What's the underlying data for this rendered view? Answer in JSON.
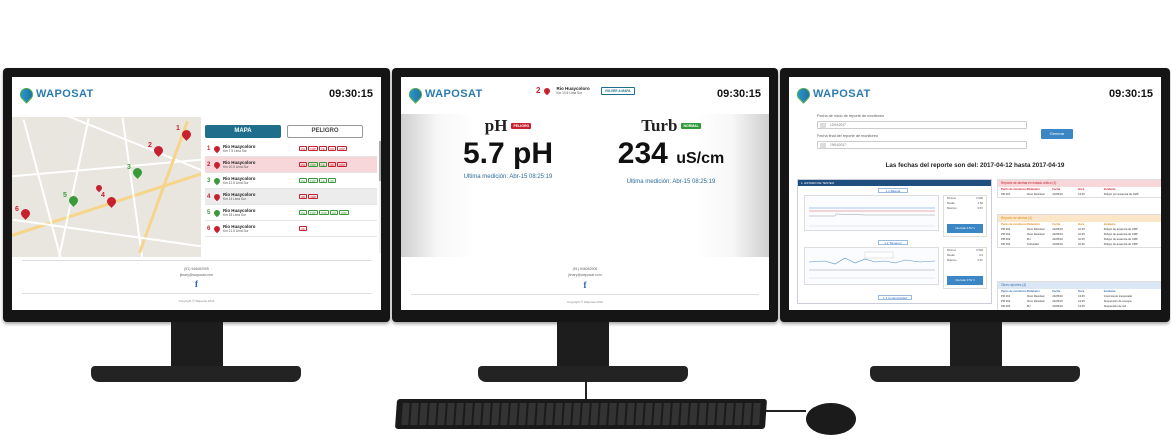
{
  "app": {
    "logo": "WAPOSAT",
    "clock": "09:30:15"
  },
  "colors": {
    "brand_blue": "#1e6e8c",
    "alert_red": "#c8202f",
    "normal_green": "#3a9a3a",
    "button_blue": "#3b86c5"
  },
  "left": {
    "tabs": [
      "MAPA",
      "PELIGRO"
    ],
    "active_tab": "MAPA",
    "map_pins": [
      {
        "num": "1",
        "status": "red"
      },
      {
        "num": "2",
        "status": "red"
      },
      {
        "num": "3",
        "status": "green"
      },
      {
        "num": "4",
        "status": "red"
      },
      {
        "num": "5",
        "status": "green"
      },
      {
        "num": "6",
        "status": "red"
      }
    ],
    "stations": [
      {
        "num": "1",
        "status": "red",
        "name": "Rio Huaycoloro",
        "loc": "Km 7.5 Lima Sur",
        "chips": [
          [
            "PH",
            "red"
          ],
          [
            "TMP",
            "red"
          ],
          [
            "CE",
            "red"
          ],
          [
            "OD",
            "red"
          ],
          [
            "ORP",
            "red"
          ]
        ]
      },
      {
        "num": "2",
        "status": "red",
        "name": "Rio Huaycoloro",
        "loc": "Km 10.5 Lima Sur",
        "chips": [
          [
            "PH",
            "red"
          ],
          [
            "TMP",
            "green"
          ],
          [
            "CE",
            "green"
          ],
          [
            "OD",
            "red"
          ],
          [
            "ORP",
            "red"
          ]
        ]
      },
      {
        "num": "3",
        "status": "green",
        "name": "Rio Huaycoloro",
        "loc": "Km 12.5 Lima Sur",
        "chips": [
          [
            "PH",
            "green"
          ],
          [
            "TMP",
            "green"
          ],
          [
            "CE",
            "green"
          ],
          [
            "OD",
            "green"
          ]
        ]
      },
      {
        "num": "4",
        "status": "red",
        "name": "Rio Huaycoloro",
        "loc": "Km 14 Lima Sur",
        "chips": [
          [
            "OD",
            "red"
          ],
          [
            "ORP",
            "red"
          ]
        ]
      },
      {
        "num": "5",
        "status": "green",
        "name": "Rio Huaycoloro",
        "loc": "Km 18 Lima Sur",
        "chips": [
          [
            "PH",
            "green"
          ],
          [
            "TMP",
            "green"
          ],
          [
            "TMP",
            "green"
          ],
          [
            "OD",
            "green"
          ],
          [
            "ORP",
            "green"
          ]
        ]
      },
      {
        "num": "6",
        "status": "red",
        "name": "Rio Huaycoloro",
        "loc": "Km 21.5 Lima Sur",
        "chips": [
          [
            "CE",
            "red"
          ]
        ]
      }
    ],
    "footer_phone": "(51) 946082905",
    "footer_email": "jlinary@waposat.com",
    "copyright": "Copyright © Waposat 2016"
  },
  "center": {
    "station": {
      "num": "2",
      "name": "Rio Huaycoloro",
      "loc": "Km 10.5 Lima Sur",
      "button": "VOLVER A MAPA"
    },
    "metrics": [
      {
        "label": "pH",
        "badge": "PELIGRO",
        "badge_color": "red",
        "value": "5.7",
        "unit": "pH",
        "measured": "Ultima medición: Abr-15 08:25:19"
      },
      {
        "label": "Turb",
        "badge": "NORMAL",
        "badge_color": "green",
        "value": "234",
        "unit": "uS/cm",
        "measured": "Ultima medición: Abr-15 08:25:19"
      }
    ],
    "footer_phone": "(51) 946082905",
    "footer_email": "jlinary@waposat.com",
    "copyright": "Copyright © Waposat 2016"
  },
  "right": {
    "start_label": "Fecha de inicio de reporte de monitoreo",
    "start_value": "12/04/2017",
    "end_label": "Fecha final del reporte de monitoreo",
    "end_value": "19/04/2017",
    "generate_button": "Generar",
    "report_title": "Las fechas del reporte son del: 2017-04-12 hasta 2017-04-19",
    "panel_title": "1. ESTADO DE TESTEO",
    "sub_tabs": [
      "1.1 Batería",
      "1.2 Tomacorr",
      "1.4 Conductividad"
    ],
    "stats1": [
      [
        "Mínimo",
        "3.500"
      ],
      [
        "Media",
        "3.56"
      ],
      [
        "Máximo",
        "3.5V"
      ]
    ],
    "stats2": [
      [
        "Mínimo",
        "3.500"
      ],
      [
        "Media",
        "3.6"
      ],
      [
        "Máximo",
        "3.5V"
      ]
    ],
    "stat_button1": "Intervalo\n3.5V 1",
    "stat_button2": "Intervalo\n3.5V 1",
    "alert_panels": [
      {
        "title": "Reporte de alertas en estado crítico (1)",
        "color": "red",
        "header": [
          "Punto de monitoreo",
          "Parámetro",
          "Fecha",
          "Hora",
          "Incidente"
        ],
        "rows": [
          [
            "PM 001",
            "Cloro Residual",
            "24/05/16",
            "13:40",
            "Peligro por ausencia de CMP"
          ]
        ]
      },
      {
        "title": "Reporte de alertas (4)",
        "color": "orange",
        "header": [
          "Punto de monitoreo",
          "Parámetro",
          "Fecha",
          "Hora",
          "Incidente"
        ],
        "rows": [
          [
            "PM 001",
            "Cloro Residual",
            "24/05/16",
            "10:45",
            "Peligro de ausencia de CMP"
          ],
          [
            "PM 002",
            "Cloro Residual",
            "24/05/16",
            "10:45",
            "Peligro de ausencia de CMP"
          ],
          [
            "PM 003",
            "PH",
            "24/05/16",
            "10:45",
            "Peligro de ausencia de CMP"
          ],
          [
            "PM 004",
            "Turbiedad",
            "24/05/16",
            "10:45",
            "Peligro de ausencia de CMP"
          ]
        ]
      },
      {
        "title": "Otros reportes (4)",
        "color": "blue",
        "header": [
          "Punto de monitoreo",
          "Parámetro",
          "Fecha",
          "Hora",
          "Incidente"
        ],
        "rows": [
          [
            "PM 001",
            "Cloro Residual",
            "24/05/16",
            "13:45",
            "Crecimiento inesperado"
          ],
          [
            "PM 002",
            "Cloro Residual",
            "24/05/16",
            "13:45",
            "Suspensión de energía"
          ],
          [
            "PM 003",
            "PH",
            "24/05/16",
            "13:45",
            "Suspensión de red"
          ],
          [
            "PM 004",
            "Turbiedad",
            "24/05/16",
            "13:45",
            "Error de equipo"
          ]
        ]
      }
    ]
  }
}
